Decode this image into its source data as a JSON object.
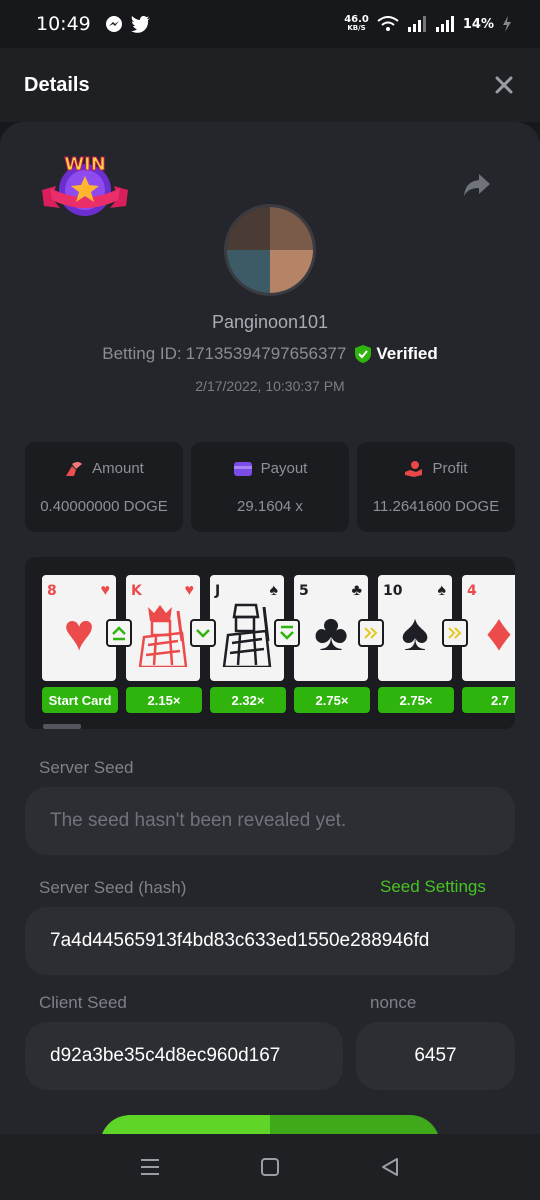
{
  "status_bar": {
    "time": "10:49",
    "app_icons": [
      "messenger-icon",
      "twitter-icon"
    ],
    "net_speed": "46.0",
    "net_speed_unit": "KB/S",
    "battery": "14%"
  },
  "header": {
    "title": "Details",
    "close_icon": "close-icon"
  },
  "bet": {
    "badge": "WIN",
    "username": "Panginoon101",
    "betting_id_label": "Betting ID:",
    "betting_id": "17135394797656377",
    "verified_label": "Verified",
    "datetime": "2/17/2022, 10:30:37 PM"
  },
  "stats": [
    {
      "label": "Amount",
      "value": "0.40000000 DOGE",
      "icon": "amount-icon",
      "color": "#e9504f"
    },
    {
      "label": "Payout",
      "value": "29.1604 x",
      "icon": "payout-icon",
      "color": "#7b4ce8"
    },
    {
      "label": "Profit",
      "value": "11.2641600 DOGE",
      "icon": "profit-icon",
      "color": "#e94848"
    }
  ],
  "cards": [
    {
      "rank": "8",
      "suit": "♥",
      "color": "red",
      "face": false,
      "action": "up",
      "multiplier": "Start Card"
    },
    {
      "rank": "K",
      "suit": "♥",
      "color": "red",
      "face": true,
      "action": "down",
      "multiplier": "2.15×"
    },
    {
      "rank": "J",
      "suit": "♠",
      "color": "black",
      "face": true,
      "action": "lower",
      "multiplier": "2.32×"
    },
    {
      "rank": "5",
      "suit": "♣",
      "color": "black",
      "face": false,
      "action": "skip",
      "multiplier": "2.75×"
    },
    {
      "rank": "10",
      "suit": "♠",
      "color": "black",
      "face": false,
      "action": "skip",
      "multiplier": "2.75×"
    },
    {
      "rank": "4",
      "suit": "♦",
      "color": "red",
      "face": false,
      "action": "",
      "multiplier": "2.7"
    }
  ],
  "server_seed": {
    "label": "Server Seed",
    "placeholder": "The seed hasn't been revealed yet."
  },
  "server_seed_hash": {
    "label": "Server Seed (hash)",
    "link": "Seed Settings",
    "value": "7a4d44565913f4bd83c633ed1550e288946fd"
  },
  "client_seed": {
    "label": "Client Seed",
    "value": "d92a3be35c4d8ec960d167"
  },
  "nonce": {
    "label": "nonce",
    "value": "6457"
  },
  "colors": {
    "accent": "#48c324",
    "verified": "#2fb40e",
    "panel": "#24262b"
  }
}
